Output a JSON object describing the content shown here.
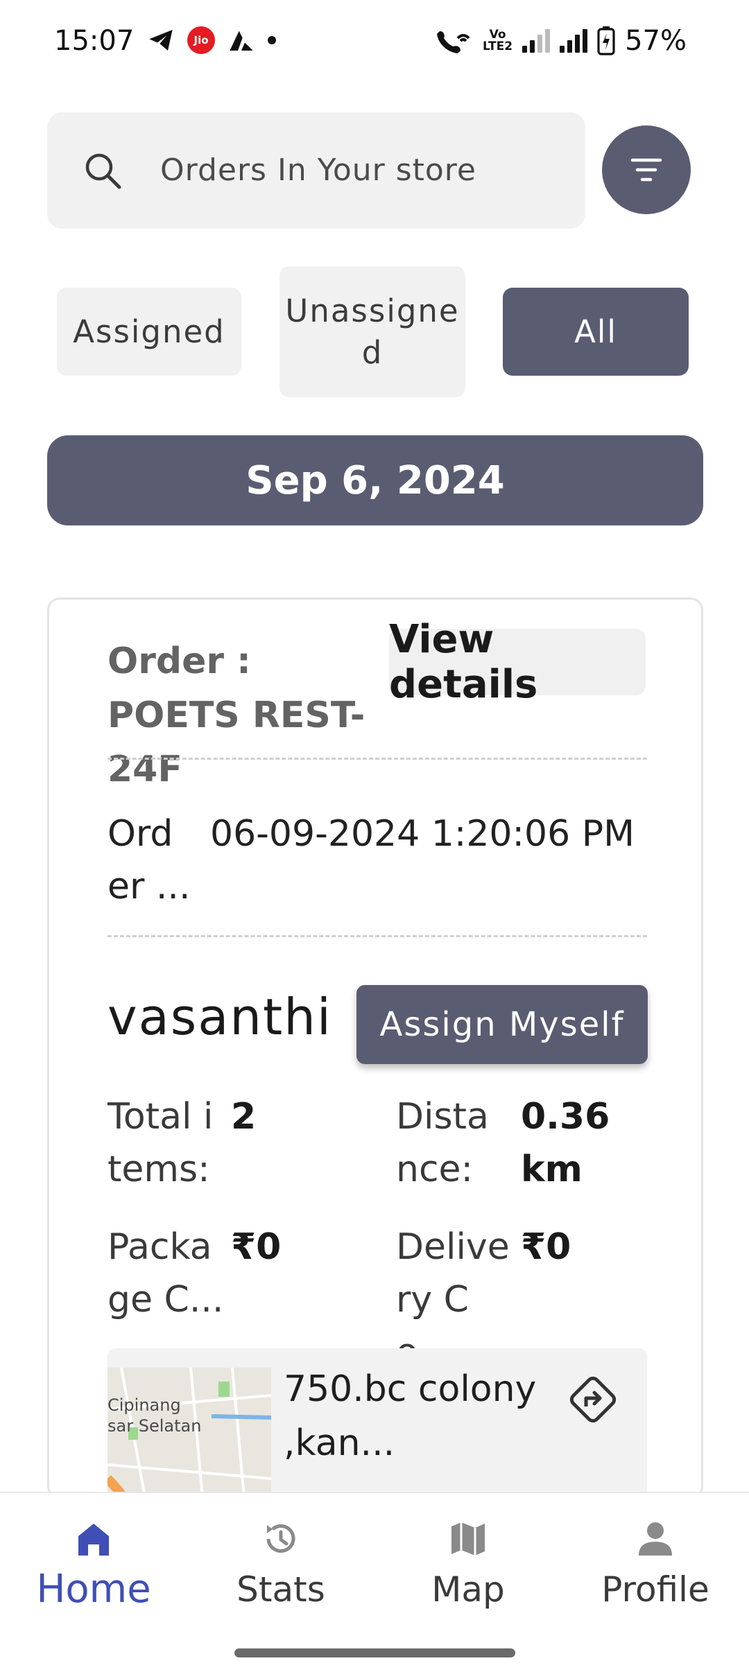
{
  "status_bar": {
    "time": "15:07",
    "jio_label": "Jio",
    "volte_top": "Vo",
    "volte_bottom": "LTE2",
    "battery": "57%"
  },
  "search": {
    "placeholder": "Orders In Your store",
    "icon": "search-icon",
    "filter_icon": "filter-icon"
  },
  "tabs": [
    {
      "label": "Assigned",
      "active": false
    },
    {
      "label": "Unassigned",
      "active": false
    },
    {
      "label": "All",
      "active": true
    }
  ],
  "date": "Sep 6, 2024",
  "order": {
    "id_line": "Order : POETS REST-24F",
    "view_details_label": "View details",
    "order_date_label": "Order ...",
    "order_date_value": "06-09-2024 1:20:06 PM",
    "customer_name": "vasanthi",
    "assign_label": "Assign Myself",
    "total_items_label": "Total items:",
    "total_items_value": "2",
    "distance_label": "Distance:",
    "distance_value": "0.36 km",
    "package_label": "Package C...",
    "package_value": "₹0",
    "delivery_label": "Delivery Co...",
    "delivery_value": "₹0",
    "address": "750.bc colony ,kan...",
    "map_text_1": "Cipinang",
    "map_text_2": "sar Selatan"
  },
  "nav": [
    {
      "label": "Home",
      "icon": "home-icon",
      "active": true
    },
    {
      "label": "Stats",
      "icon": "history-icon",
      "active": false
    },
    {
      "label": "Map",
      "icon": "map-icon",
      "active": false
    },
    {
      "label": "Profile",
      "icon": "person-icon",
      "active": false
    }
  ],
  "colors": {
    "accent": "#5a5c72",
    "nav_active": "#3f4fb5",
    "chip_bg": "#f1f1f1"
  }
}
